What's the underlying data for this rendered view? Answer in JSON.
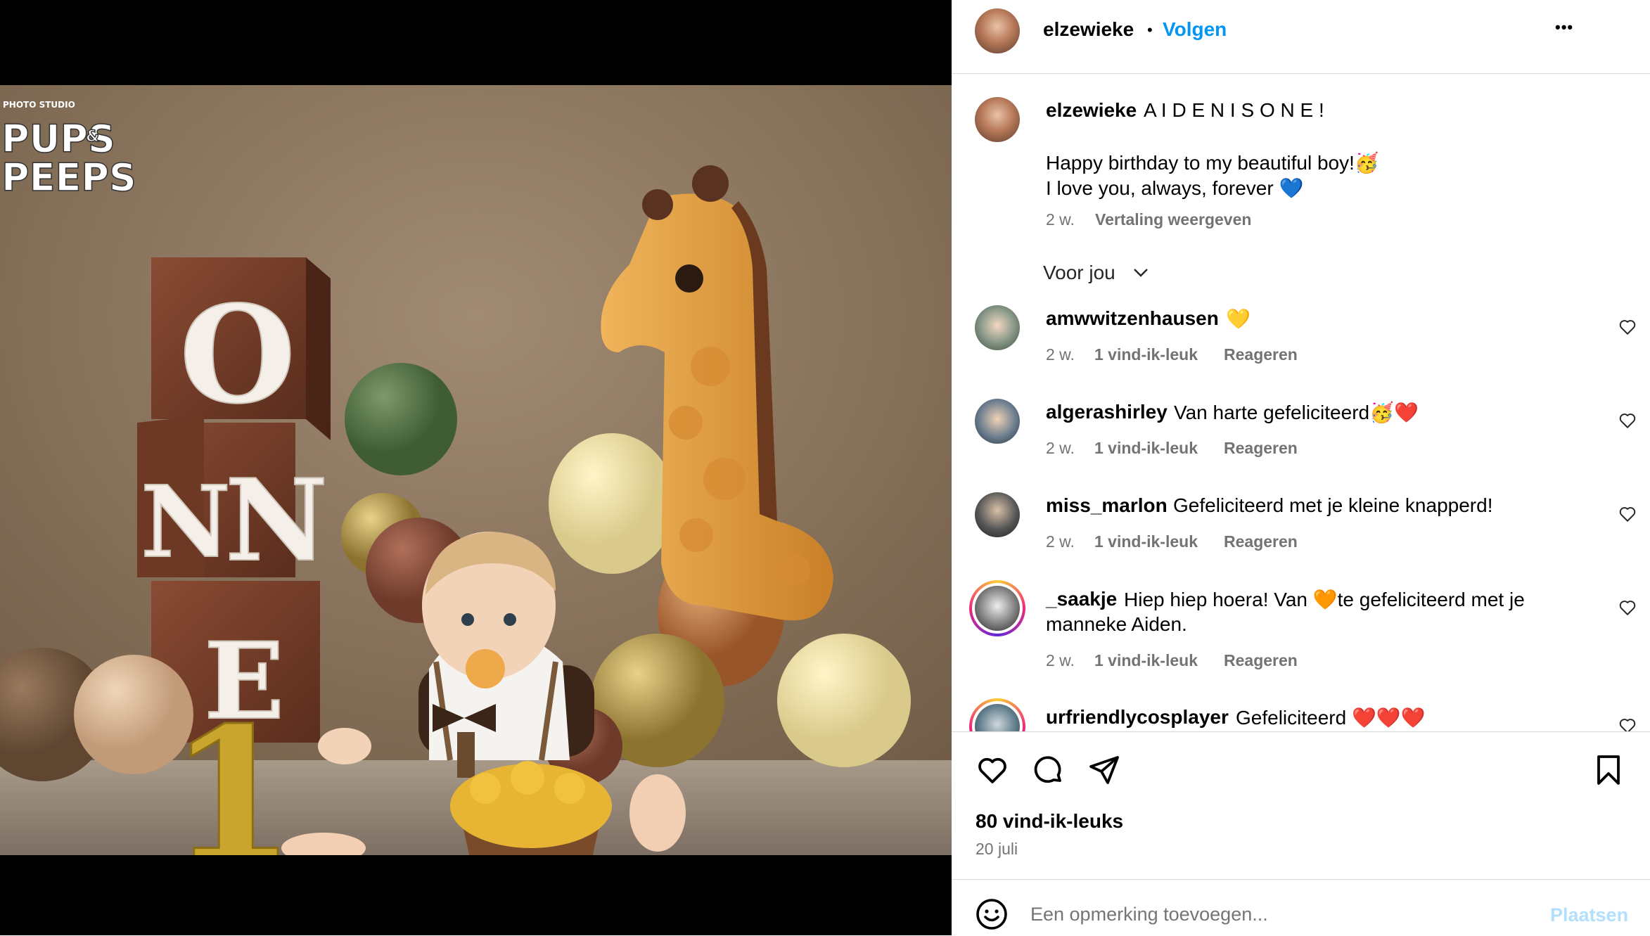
{
  "photo": {
    "watermark": {
      "small": "PHOTO STUDIO",
      "line1": "PUPS",
      "amp": "&",
      "line2": "PEEPS"
    },
    "block_letters": [
      "O",
      "N",
      "N",
      "E"
    ],
    "gold_number": "1"
  },
  "header": {
    "username": "elzewieke",
    "separator": "•",
    "follow_label": "Volgen",
    "more_label": "•••"
  },
  "caption": {
    "username": "elzewieke",
    "title": "A I D E N I S O N E !",
    "line1": "Happy birthday to my beautiful boy!🥳",
    "line2": "I love you, always, forever 💙",
    "time": "2 w.",
    "translate_label": "Vertaling weergeven"
  },
  "filter_label": "Voor jou",
  "comments": [
    {
      "user": "amwwitzenhausen",
      "text": "💛",
      "time": "2 w.",
      "likes": "1 vind-ik-leuk",
      "reply": "Reageren"
    },
    {
      "user": "algerashirley",
      "text": "Van harte gefeliciteerd🥳❤️",
      "time": "2 w.",
      "likes": "1 vind-ik-leuk",
      "reply": "Reageren"
    },
    {
      "user": "miss_marlon",
      "text": "Gefeliciteerd met je kleine knapperd!",
      "time": "2 w.",
      "likes": "1 vind-ik-leuk",
      "reply": "Reageren"
    },
    {
      "user": "_saakje",
      "text": "Hiep hiep hoera! Van 🧡te gefeliciteerd met je",
      "text2": "manneke Aiden.",
      "time": "2 w.",
      "likes": "1 vind-ik-leuk",
      "reply": "Reageren"
    },
    {
      "user": "urfriendlycosplayer",
      "text": "Gefeliciteerd ❤️❤️❤️"
    }
  ],
  "actions": {
    "likes_count": "80 vind-ik-leuks",
    "date": "20 juli"
  },
  "comment_box": {
    "placeholder": "Een opmerking toevoegen...",
    "post_label": "Plaatsen"
  },
  "colors": {
    "accent": "#0095f6",
    "post_disabled": "#b2dffc",
    "meta_gray": "#737373",
    "divider": "#dbdbdb"
  },
  "icons": [
    "heart-icon",
    "comment-icon",
    "share-icon",
    "bookmark-icon",
    "emoji-icon",
    "chevron-down-icon",
    "more-icon"
  ]
}
